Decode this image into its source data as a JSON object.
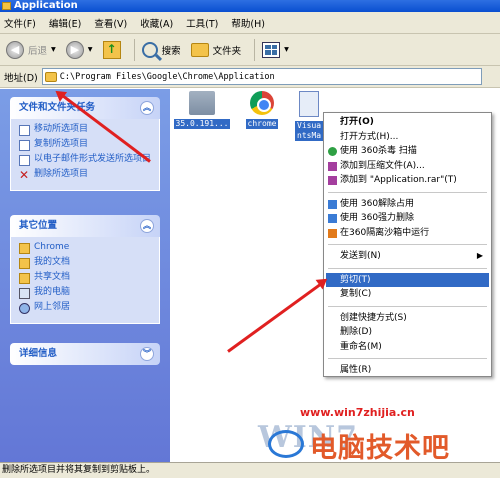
{
  "window": {
    "title": "Application"
  },
  "menubar": [
    "文件(F)",
    "编辑(E)",
    "查看(V)",
    "收藏(A)",
    "工具(T)",
    "帮助(H)"
  ],
  "toolbar": {
    "back_label": "后退",
    "search_label": "搜索",
    "folders_label": "文件夹"
  },
  "address": {
    "label": "地址(D)",
    "path": "C:\\Program Files\\Google\\Chrome\\Application"
  },
  "tasks_panel": {
    "title": "文件和文件夹任务",
    "items": [
      "移动所选项目",
      "复制所选项目",
      "以电子邮件形式发送所选项目",
      "删除所选项目"
    ]
  },
  "places_panel": {
    "title": "其它位置",
    "items": [
      "Chrome",
      "我的文档",
      "共享文档",
      "我的电脑",
      "网上邻居"
    ]
  },
  "details_panel": {
    "title": "详细信息"
  },
  "files": [
    {
      "name": "35.0.191...",
      "icon": "folder-icon"
    },
    {
      "name": "chrome",
      "icon": "chrome-icon"
    },
    {
      "name": "Visua ntsMa",
      "icon": "exe-icon"
    }
  ],
  "context_menu": {
    "items": [
      "打开(O)",
      "打开方式(H)...",
      "使用 360杀毒 扫描",
      "添加到压缩文件(A)...",
      "添加到 \"Application.rar\"(T)",
      "使用 360解除占用",
      "使用 360强力删除",
      "在360隔离沙箱中运行",
      "发送到(N)",
      "剪切(T)",
      "复制(C)",
      "创建快捷方式(S)",
      "删除(D)",
      "重命名(M)",
      "属性(R)"
    ]
  },
  "watermark": {
    "site": "www.win7zhijia.cn",
    "win_text": "WIN7",
    "brand": "电脑技术吧"
  },
  "status": {
    "text": "删除所选项目并将其复制到剪贴板上。"
  },
  "colors": {
    "selection": "#316ac5",
    "arrow": "#e02020",
    "taskpane": "#6f8ae0"
  }
}
